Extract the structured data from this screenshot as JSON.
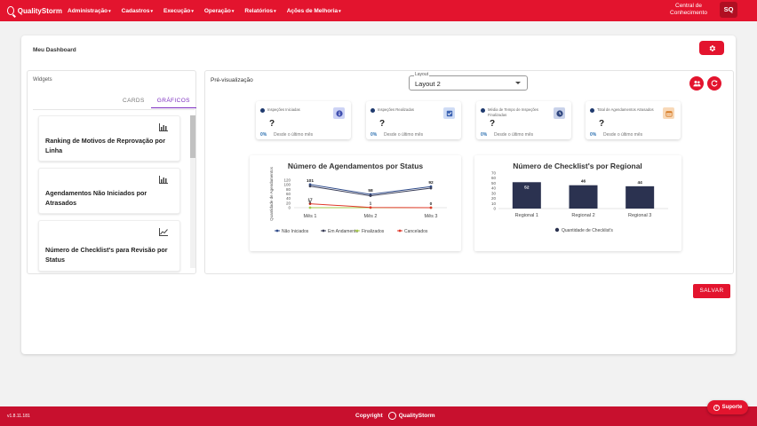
{
  "topbar": {
    "brand": "QualityStorm",
    "nav": [
      {
        "label": "Administração"
      },
      {
        "label": "Cadastros"
      },
      {
        "label": "Execução"
      },
      {
        "label": "Operação"
      },
      {
        "label": "Relatórios"
      },
      {
        "label": "Ações de Melhoria"
      }
    ],
    "central": "Central de Conhecimento",
    "avatar": "SQ"
  },
  "page": {
    "title": "Meu Dashboard"
  },
  "widgets": {
    "title": "Widgets",
    "tabs": [
      "CARDS",
      "GRÁFICOS"
    ],
    "active_tab": "GRÁFICOS",
    "items": [
      {
        "label": "Ranking de Motivos de Reprovação por Linha",
        "icon": "bar-chart-icon"
      },
      {
        "label": "Agendamentos Não Iniciados por Atrasados",
        "icon": "bar-chart-icon"
      },
      {
        "label": "Número de Checklist's para Revisão por Status",
        "icon": "line-chart-icon"
      }
    ]
  },
  "preview": {
    "title": "Pré-visualização",
    "layout_label": "Layout",
    "layout_value": "Layout 2",
    "kpis": [
      {
        "title": "Inspeções Iniciadas",
        "value": "?",
        "pct": "0%",
        "desc": "Desde o último mês",
        "icon": "info-icon",
        "icon_color": "#5b6bc9"
      },
      {
        "title": "Inspeções Realizadas",
        "value": "?",
        "pct": "0%",
        "desc": "Desde o último mês",
        "icon": "checklist-icon",
        "icon_color": "#5a7fc2"
      },
      {
        "title": "Média de Tempo de Inspeções Finalizadas",
        "value": "?",
        "pct": "0%",
        "desc": "Desde o último mês",
        "icon": "clock-icon",
        "icon_color": "#4a64a8"
      },
      {
        "title": "Total de Agendamentos Atrasados",
        "value": "?",
        "pct": "0%",
        "desc": "Desde o último mês",
        "icon": "calendar-icon",
        "icon_color": "#e8a25a"
      }
    ]
  },
  "chart_data": [
    {
      "type": "line",
      "title": "Número de Agendamentos por Status",
      "ylabel": "Quantidade de Agendamentos",
      "categories": [
        "Mês 1",
        "Mês 2",
        "Mês 3"
      ],
      "y_ticks": [
        "120",
        "100",
        "80",
        "60",
        "40",
        "20",
        "0"
      ],
      "ylim": [
        0,
        120
      ],
      "series": [
        {
          "name": "Não Iniciados",
          "color": "#2f4b8a",
          "values": [
            101,
            58,
            92
          ],
          "labels": [
            "101",
            "58",
            "92"
          ]
        },
        {
          "name": "Em Andamento",
          "color": "#3b3f58",
          "values": [
            94,
            52,
            85
          ],
          "labels": [
            "",
            "",
            ""
          ]
        },
        {
          "name": "Finalizados",
          "color": "#a6c94b",
          "values": [
            0,
            0,
            0
          ],
          "labels": [
            "",
            "",
            ""
          ]
        },
        {
          "name": "Cancelados",
          "color": "#e0392b",
          "values": [
            17,
            1,
            0
          ],
          "labels": [
            "17",
            "1",
            "0"
          ]
        }
      ],
      "extra_labels": [
        {
          "series": 2,
          "index": 0,
          "text": "0"
        }
      ]
    },
    {
      "type": "bar",
      "title": "Número de Checklist's por Regional",
      "categories": [
        "Regional 1",
        "Regional 2",
        "Regional 3"
      ],
      "values": [
        52,
        46,
        44
      ],
      "y_ticks": [
        "70",
        "60",
        "50",
        "40",
        "30",
        "20",
        "10",
        "0"
      ],
      "ylim": [
        0,
        70
      ],
      "series_name": "Quantidade de Checklist's",
      "color": "#2b3250"
    }
  ],
  "actions": {
    "save": "SALVAR"
  },
  "footer": {
    "version": "v1.8.11.181",
    "copyright": "Copyright",
    "brand": "QualityStorm",
    "support": "Suporte"
  }
}
